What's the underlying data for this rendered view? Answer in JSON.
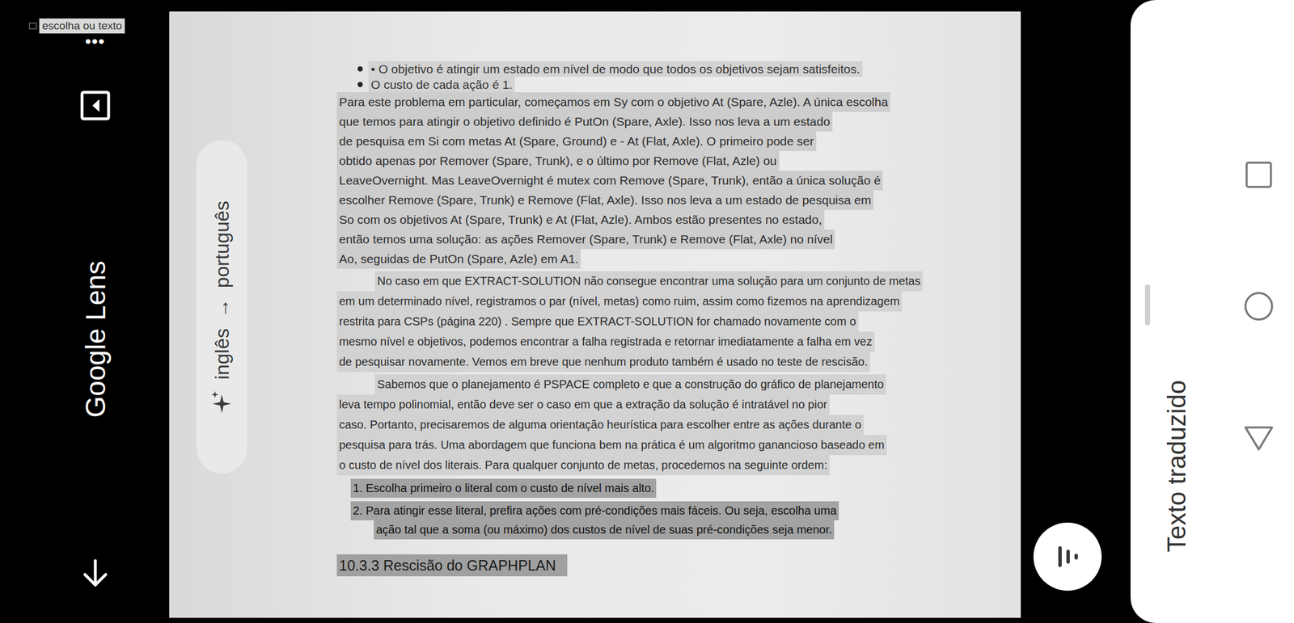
{
  "lens": {
    "title": "Google Lens",
    "hint": "escolha ou texto",
    "more": "•••",
    "language": {
      "from": "inglês",
      "arrow": "→",
      "to": "português"
    }
  },
  "document": {
    "blocks": [
      {
        "kind": "bullet",
        "lines": [
          "• O objetivo é atingir um estado em nível de modo que todos os objetivos sejam satisfeitos."
        ]
      },
      {
        "kind": "bullet",
        "lines": [
          "O custo de cada ação é 1."
        ]
      },
      {
        "kind": "lead",
        "lines": [
          "Para este problema em particular, começamos em Sy com o objetivo At (Spare, Azle). A única escolha",
          "que temos para atingir o objetivo definido é PutOn (Spare, Axle). Isso nos leva a um estado",
          "de pesquisa em Si com metas At (Spare, Ground) e - At (Flat, Axle). O primeiro pode ser",
          "obtido apenas por Remover (Spare, Trunk), e o último por Remove (Flat, Azle) ou",
          "LeaveOvernight. Mas LeaveOvernight é mutex com Remove (Spare, Trunk), então a única solução é",
          "escolher Remove (Spare, Trunk) e Remove (Flat, Axle). Isso nos leva a um estado de pesquisa em",
          "So com os objetivos At (Spare, Trunk) e At (Flat, Azle). Ambos estão presentes no estado,",
          "então temos uma solução: as ações Remover (Spare, Trunk) e Remove (Flat, Axle) no nível",
          "Ao, seguidas de PutOn (Spare, Azle) em A1."
        ]
      },
      {
        "kind": "paragraph",
        "lines": [
          "No caso em que EXTRACT-SOLUTION não consegue encontrar uma solução para um conjunto de metas",
          "em um determinado nível, registramos o par (nível, metas) como ruim, assim como fizemos na aprendizagem",
          "restrita para CSPs (página 220) . Sempre que EXTRACT-SOLUTION for chamado novamente com o",
          "mesmo nível e objetivos, podemos encontrar a falha registrada e retornar imediatamente a falha em vez",
          "de pesquisar novamente. Vemos em breve que nenhum produto também é usado no teste de rescisão."
        ]
      },
      {
        "kind": "paragraph",
        "lines": [
          "Sabemos que o planejamento é PSPACE completo e que a construção do gráfico de planejamento",
          "leva tempo polinomial, então deve ser o caso em que a extração da solução é intratável no pior",
          "caso. Portanto, precisaremos de alguma orientação heurística para escolher entre as ações durante o",
          "pesquisa para trás. Uma abordagem que funciona bem na prática é um algoritmo ganancioso baseado em",
          "o custo de nível dos literais. Para qualquer conjunto de metas, procedemos na seguinte ordem:"
        ]
      },
      {
        "kind": "item",
        "lines": [
          "1. Escolha primeiro o literal com o custo de nível mais alto."
        ]
      },
      {
        "kind": "item",
        "lines": [
          "2. Para atingir esse literal, prefira ações com pré-condições mais fáceis. Ou seja, escolha uma",
          "ação tal que a soma (ou máximo) dos custos de nível de suas pré-condições seja menor."
        ]
      },
      {
        "kind": "heading",
        "lines": [
          "10.3.3 Rescisão do GRAPHPLAN"
        ]
      }
    ]
  },
  "panel": {
    "title": "Texto traduzido"
  }
}
